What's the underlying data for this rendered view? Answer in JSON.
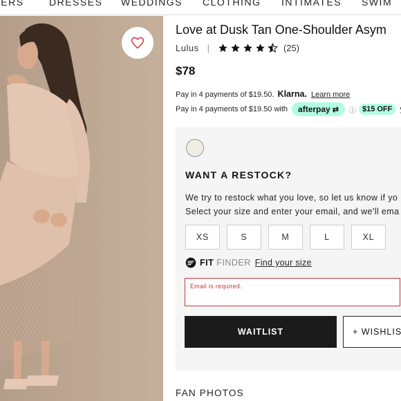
{
  "nav": {
    "items": [
      "LERS",
      "DRESSES",
      "WEDDINGS",
      "CLOTHING",
      "INTIMATES",
      "SWIM"
    ]
  },
  "product": {
    "title": "Love at Dusk Tan One-Shoulder Asym",
    "brand": "Lulus",
    "rating": 4.5,
    "review_count": "(25)",
    "price": "$78"
  },
  "klarna": {
    "text": "Pay in 4 payments of $19.50.",
    "brand": "Klarna.",
    "link": "Learn more"
  },
  "afterpay": {
    "text": "Pay in 4 payments of $19.50 with",
    "brand": "afterpay",
    "discount": "$15 OFF",
    "tail": "you"
  },
  "restock": {
    "heading": "WANT A RESTOCK?",
    "line1": "We try to restock what you love, so let us know if yo",
    "line2": "Select your size and enter your email, and we'll ema",
    "sizes": [
      "XS",
      "S",
      "M",
      "L",
      "XL"
    ],
    "fit_bold": "FIT",
    "fit_light": "FINDER",
    "fit_link": "Find your size",
    "email_error": "Email is required.",
    "waitlist_label": "WAITLIST",
    "wishlist_label": "+ WISHLIST"
  },
  "fan_photos": "FAN PHOTOS",
  "colors": {
    "afterpay_mint": "#b2fce4",
    "error_red": "#c9353d",
    "button_dark": "#1b1b1b",
    "heart": "#c9353d",
    "swatch": "#f1ece4"
  },
  "icons": {
    "favorite": "heart-icon",
    "star": "star-icon",
    "fit_finder": "fit-finder-icon",
    "info": "info-icon"
  }
}
